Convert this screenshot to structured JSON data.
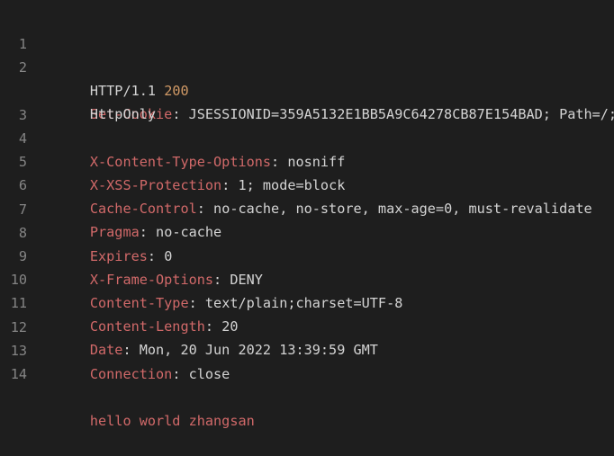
{
  "editor": {
    "lines": [
      {
        "num": "1",
        "version": "HTTP/1.1",
        "status": "200"
      },
      {
        "num": "2",
        "key": "Set-Cookie",
        "value": "JSESSIONID=359A5132E1BB5A9C64278CB87E154BAD; Path=/;",
        "continuation": "HttpOnly"
      },
      {
        "num": "3",
        "key": "X-Content-Type-Options",
        "value": "nosniff"
      },
      {
        "num": "4",
        "key": "X-XSS-Protection",
        "value": "1; mode=block"
      },
      {
        "num": "5",
        "key": "Cache-Control",
        "value": "no-cache, no-store, max-age=0, must-revalidate"
      },
      {
        "num": "6",
        "key": "Pragma",
        "value": "no-cache"
      },
      {
        "num": "7",
        "key": "Expires",
        "value": "0"
      },
      {
        "num": "8",
        "key": "X-Frame-Options",
        "value": "DENY"
      },
      {
        "num": "9",
        "key": "Content-Type",
        "value": "text/plain;charset=UTF-8"
      },
      {
        "num": "10",
        "key": "Content-Length",
        "value": "20"
      },
      {
        "num": "11",
        "key": "Date",
        "value": "Mon, 20 Jun 2022 13:39:59 GMT"
      },
      {
        "num": "12",
        "key": "Connection",
        "value": "close"
      },
      {
        "num": "13"
      },
      {
        "num": "14",
        "body": "hello world zhangsan"
      }
    ]
  },
  "colors": {
    "background": "#1e1e1e",
    "line_number": "#858585",
    "header_key": "#d16969",
    "status_code": "#d19a66",
    "text": "#d4d4d4"
  }
}
